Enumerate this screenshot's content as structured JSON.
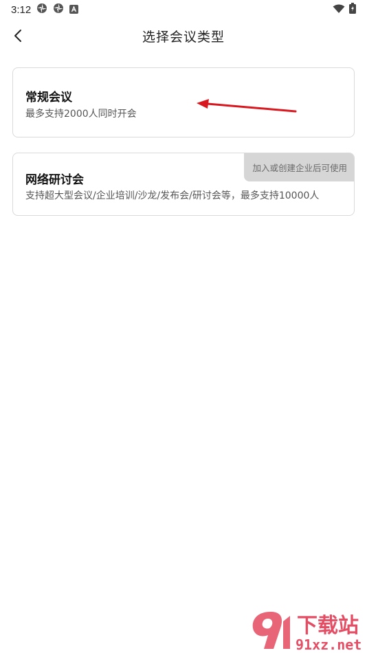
{
  "status_bar": {
    "time": "3:12",
    "icons": [
      "app-notification-icon",
      "app-notification-icon",
      "android-notification-icon",
      "wifi-icon",
      "battery-charging-icon"
    ]
  },
  "header": {
    "back_icon": "chevron-left-icon",
    "title": "选择会议类型"
  },
  "options": [
    {
      "title": "常规会议",
      "description": "最多支持2000人同时开会"
    },
    {
      "title": "网络研讨会",
      "description": "支持超大型会议/企业培训/沙龙/发布会/研讨会等，最多支持10000人",
      "badge": "加入或创建企业后可使用"
    }
  ],
  "annotation": {
    "arrow_color": "#d9171f"
  },
  "watermark": {
    "site_name": "下载站",
    "site_domain": "91xz.net",
    "color": "#e0304a"
  }
}
